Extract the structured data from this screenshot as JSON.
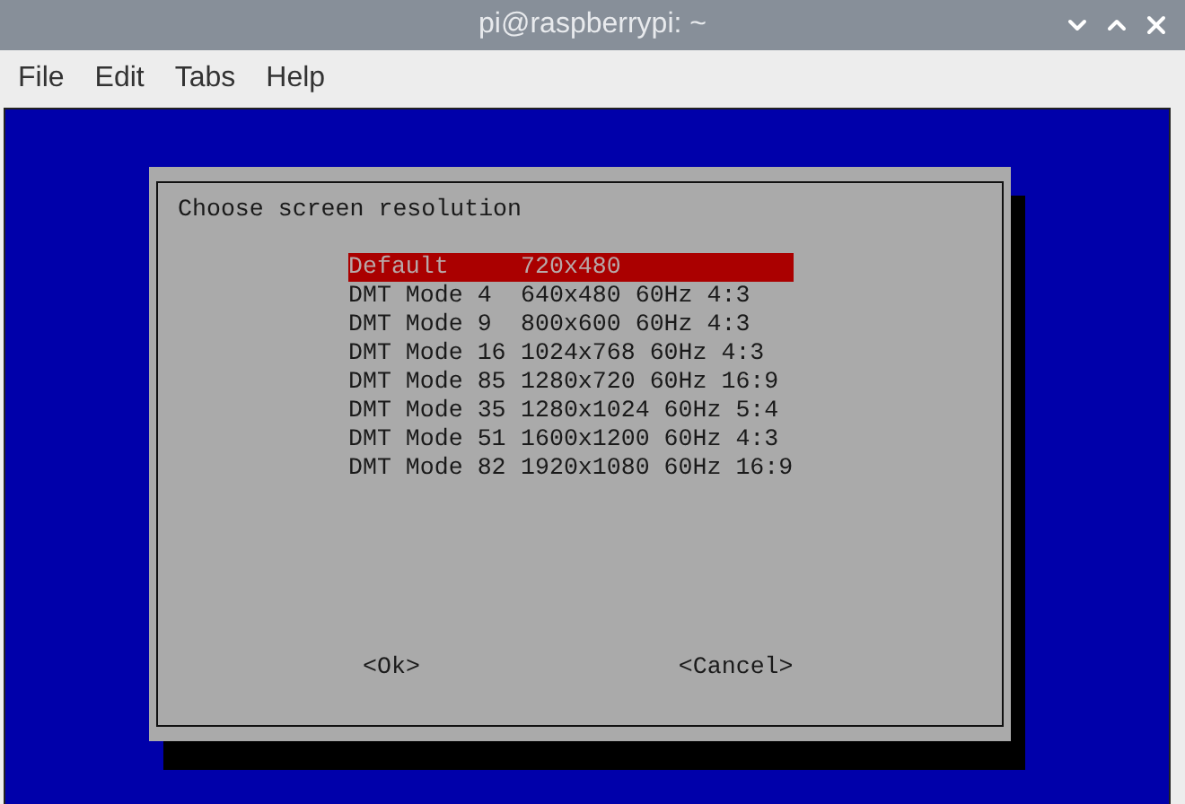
{
  "window": {
    "title": "pi@raspberrypi: ~"
  },
  "menu": [
    "File",
    "Edit",
    "Tabs",
    "Help"
  ],
  "dialog": {
    "title": "Choose screen resolution",
    "options": [
      {
        "tag": "Default",
        "description": "720x480",
        "selected": true
      },
      {
        "tag": "DMT Mode 4",
        "description": "640x480 60Hz 4:3",
        "selected": false
      },
      {
        "tag": "DMT Mode 9",
        "description": "800x600 60Hz 4:3",
        "selected": false
      },
      {
        "tag": "DMT Mode 16",
        "description": "1024x768 60Hz 4:3",
        "selected": false
      },
      {
        "tag": "DMT Mode 85",
        "description": "1280x720 60Hz 16:9",
        "selected": false
      },
      {
        "tag": "DMT Mode 35",
        "description": "1280x1024 60Hz 5:4",
        "selected": false
      },
      {
        "tag": "DMT Mode 51",
        "description": "1600x1200 60Hz 4:3",
        "selected": false
      },
      {
        "tag": "DMT Mode 82",
        "description": "1920x1080 60Hz 16:9",
        "selected": false
      }
    ],
    "buttons": [
      "<Ok>",
      "<Cancel>"
    ]
  }
}
